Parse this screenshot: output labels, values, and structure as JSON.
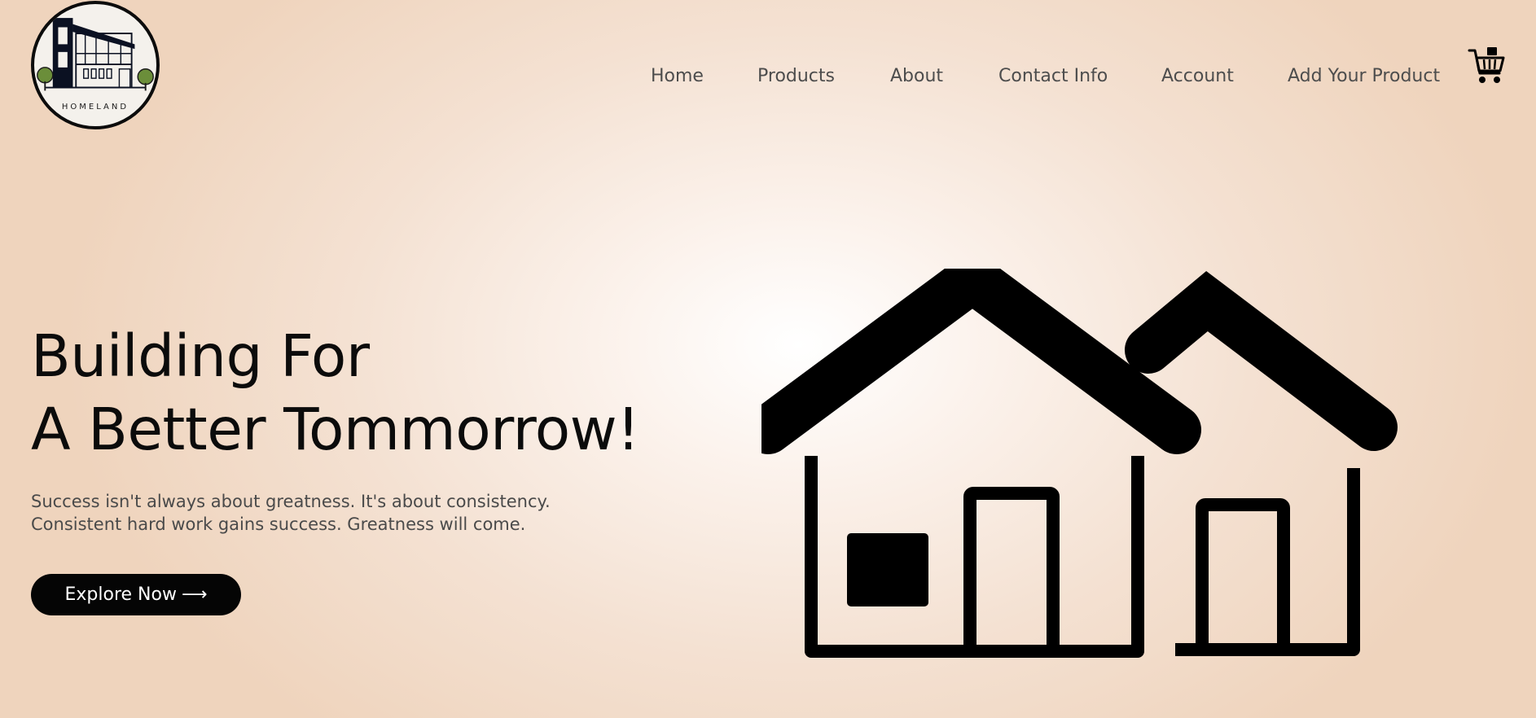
{
  "brand": {
    "logo_text": "HOMELAND",
    "colors": {
      "dark": "#0b1122",
      "accent_green": "#6b8e3a",
      "background": "#f4e1d2"
    }
  },
  "nav": {
    "items": [
      {
        "label": "Home"
      },
      {
        "label": "Products"
      },
      {
        "label": "About"
      },
      {
        "label": "Contact Info"
      },
      {
        "label": "Account"
      },
      {
        "label": "Add Your Product"
      }
    ],
    "cart_icon": "shopping-cart-icon"
  },
  "hero": {
    "title_line1": "Building For",
    "title_line2": "A Better Tommorrow!",
    "subtitle_line1": "Success isn't always about greatness. It's about consistency.",
    "subtitle_line2": "Consistent hard work gains success. Greatness will come.",
    "cta_label": "Explore Now",
    "cta_arrow": "⟶",
    "illustration": "houses-icon"
  }
}
